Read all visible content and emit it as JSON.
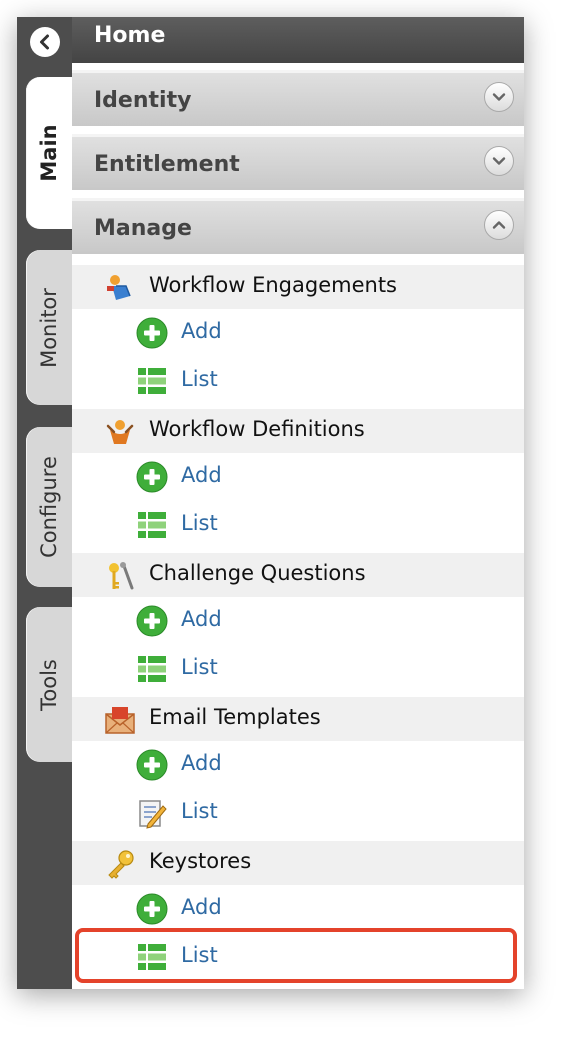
{
  "home": {
    "title": "Home"
  },
  "tabs": [
    {
      "label": "Main",
      "active": true
    },
    {
      "label": "Monitor",
      "active": false
    },
    {
      "label": "Configure",
      "active": false
    },
    {
      "label": "Tools",
      "active": false
    }
  ],
  "sections": [
    {
      "title": "Identity",
      "state": "collapsed"
    },
    {
      "title": "Entitlement",
      "state": "collapsed"
    },
    {
      "title": "Manage",
      "state": "expanded"
    }
  ],
  "manage": {
    "groups": [
      {
        "label": "Workflow Engagements",
        "icon": "workflow-engagements-icon",
        "items": [
          {
            "label": "Add",
            "icon": "add-icon"
          },
          {
            "label": "List",
            "icon": "list-icon"
          }
        ]
      },
      {
        "label": "Workflow Definitions",
        "icon": "workflow-definitions-icon",
        "items": [
          {
            "label": "Add",
            "icon": "add-icon"
          },
          {
            "label": "List",
            "icon": "list-icon"
          }
        ]
      },
      {
        "label": "Challenge Questions",
        "icon": "challenge-questions-icon",
        "items": [
          {
            "label": "Add",
            "icon": "add-icon"
          },
          {
            "label": "List",
            "icon": "list-icon"
          }
        ]
      },
      {
        "label": "Email Templates",
        "icon": "email-templates-icon",
        "items": [
          {
            "label": "Add",
            "icon": "add-icon"
          },
          {
            "label": "List",
            "icon": "edit-list-icon"
          }
        ]
      },
      {
        "label": "Keystores",
        "icon": "keystores-icon",
        "items": [
          {
            "label": "Add",
            "icon": "add-icon"
          },
          {
            "label": "List",
            "icon": "list-icon"
          }
        ]
      }
    ]
  },
  "colors": {
    "tabbar": "#4d4d4d",
    "link": "#2f6aa3",
    "highlight": "#e4432b",
    "add_green": "#3fae3a"
  }
}
